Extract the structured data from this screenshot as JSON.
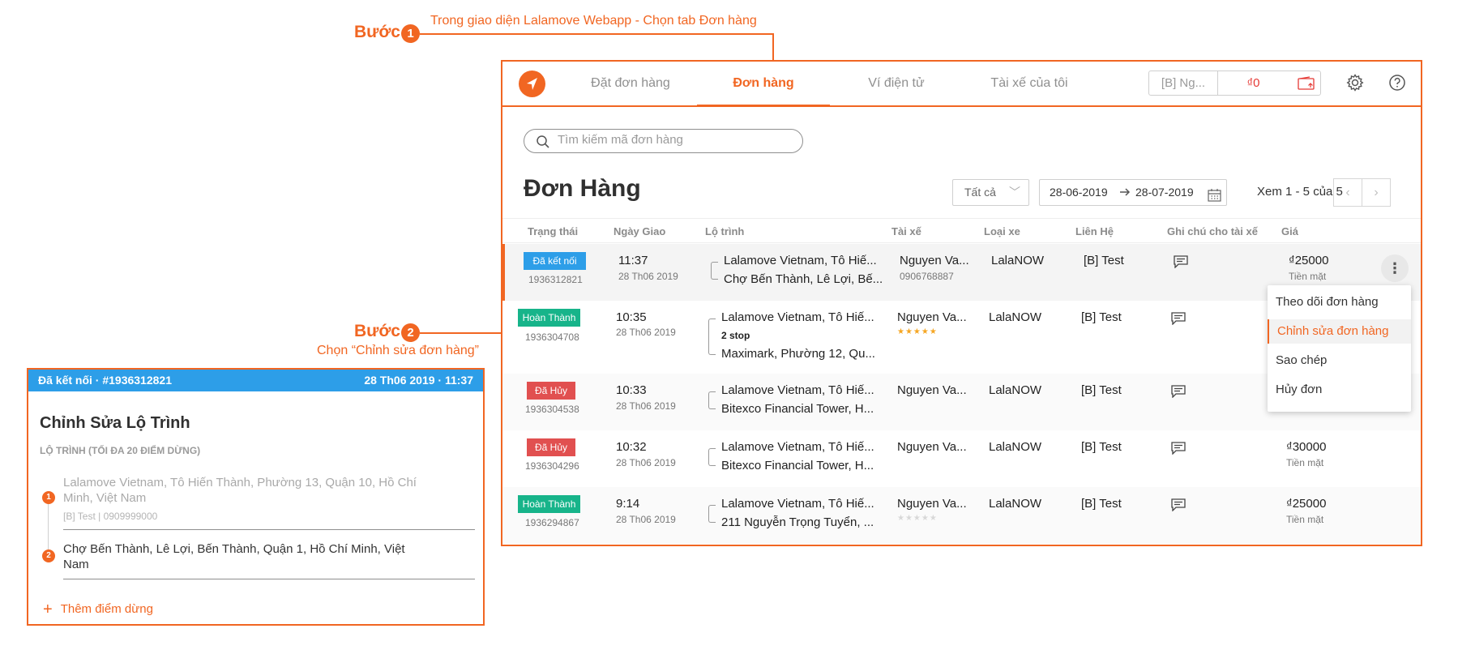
{
  "annotations": {
    "step_word": "Bước",
    "step1_number": "1",
    "step1_text": "Trong giao diện Lalamove Webapp - Chọn tab Đơn hàng",
    "step2_number": "2",
    "step2_text": "Chọn “Chỉnh sửa đơn hàng”",
    "accent_color": "#f16622"
  },
  "navbar": {
    "logo_icon": "lalamove-logo-icon",
    "tabs": [
      {
        "label": "Đặt đơn hàng",
        "active": false
      },
      {
        "label": "Đơn hàng",
        "active": true
      },
      {
        "label": "Ví điện tử",
        "active": false
      },
      {
        "label": "Tài xế của tôi",
        "active": false
      }
    ],
    "account_name": "[B] Ng...",
    "balance": "₫0",
    "wallet_icon": "wallet-topup-icon",
    "settings_icon": "gear-icon",
    "help_icon": "help-icon"
  },
  "search": {
    "placeholder": "Tìm kiếm mã đơn hàng"
  },
  "orders": {
    "title": "Đơn Hàng",
    "filter_value": "Tất cả",
    "date_from": "28-06-2019",
    "date_to": "28-07-2019",
    "pagination": "Xem 1 - 5 của 5",
    "columns": [
      "Trạng thái",
      "Ngày Giao",
      "Lộ trình",
      "Tài xế",
      "Loại xe",
      "Liên Hệ",
      "Ghi chú cho tài xế",
      "Giá"
    ],
    "rows": [
      {
        "status": "Đã kết nối",
        "status_color": "#2d9ee8",
        "id": "1936312821",
        "time": "11:37",
        "date": "28 Th06 2019",
        "from": "Lalamove Vietnam, Tô Hiế...",
        "to": "Chợ Bến Thành, Lê Lợi, Bế...",
        "driver": "Nguyen Va...",
        "driver_phone": "0906768887",
        "vehicle": "LalaNOW",
        "contact": "[B] Test",
        "price": "₫25000",
        "payment": "Tiền mặt"
      },
      {
        "status": "Hoàn Thành",
        "status_color": "#17b48a",
        "id": "1936304708",
        "time": "10:35",
        "date": "28 Th06 2019",
        "from": "Lalamove Vietnam, Tô Hiế...",
        "stops": "2 stop",
        "to": "Maximark, Phường 12, Qu...",
        "driver": "Nguyen Va...",
        "rating_stars": 5,
        "vehicle": "LalaNOW",
        "contact": "[B] Test"
      },
      {
        "status": "Đã Hủy",
        "status_color": "#e15050",
        "id": "1936304538",
        "time": "10:33",
        "date": "28 Th06 2019",
        "from": "Lalamove Vietnam, Tô Hiế...",
        "to": "Bitexco Financial Tower, H...",
        "driver": "Nguyen Va...",
        "vehicle": "LalaNOW",
        "contact": "[B] Test"
      },
      {
        "status": "Đã Hủy",
        "status_color": "#e15050",
        "id": "1936304296",
        "time": "10:32",
        "date": "28 Th06 2019",
        "from": "Lalamove Vietnam, Tô Hiế...",
        "to": "Bitexco Financial Tower, H...",
        "driver": "Nguyen Va...",
        "vehicle": "LalaNOW",
        "contact": "[B] Test",
        "price": "₫30000",
        "payment": "Tiền mặt"
      },
      {
        "status": "Hoàn Thành",
        "status_color": "#17b48a",
        "id": "1936294867",
        "time": "9:14",
        "date": "28 Th06 2019",
        "from": "Lalamove Vietnam, Tô Hiế...",
        "to": "211 Nguyễn Trọng Tuyển, ...",
        "driver": "Nguyen Va...",
        "rating_stars": 0,
        "vehicle": "LalaNOW",
        "contact": "[B] Test",
        "price": "₫25000",
        "payment": "Tiền mặt"
      }
    ]
  },
  "context_menu": {
    "items": [
      "Theo dõi đơn hàng",
      "Chỉnh sửa đơn hàng",
      "Sao chép",
      "Hủy đơn"
    ],
    "highlighted": "Chỉnh sửa đơn hàng"
  },
  "edit_panel": {
    "header_left": "Đã kết nối · #1936312821",
    "header_right": "28 Th06 2019 · 11:37",
    "title": "Chỉnh Sửa Lộ Trình",
    "subtitle": "LỘ TRÌNH (TỐI ĐA 20 ĐIỂM DỪNG)",
    "stops": [
      {
        "number": "1",
        "address": "Lalamove Vietnam, Tô Hiến Thành, Phường 13, Quận 10, Hồ Chí Minh, Việt Nam",
        "contact": "[B] Test | 0909999000"
      },
      {
        "number": "2",
        "address": "Chợ Bến Thành, Lê Lợi, Bến Thành, Quận 1, Hồ Chí Minh, Việt Nam"
      }
    ],
    "add_stop_label": "Thêm điểm dừng"
  }
}
